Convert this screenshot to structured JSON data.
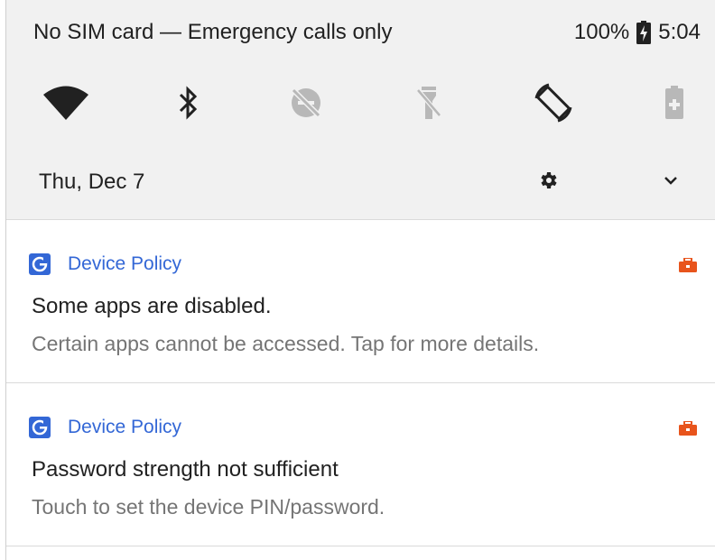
{
  "status_bar": {
    "carrier_text": "No SIM card — Emergency calls only",
    "battery_percent": "100%",
    "battery_icon": "battery-charging-icon",
    "time": "5:04"
  },
  "quick_settings": {
    "tiles": [
      {
        "icon": "wifi-icon",
        "state": "on"
      },
      {
        "icon": "bluetooth-icon",
        "state": "on"
      },
      {
        "icon": "do-not-disturb-off-icon",
        "state": "off"
      },
      {
        "icon": "flashlight-off-icon",
        "state": "off"
      },
      {
        "icon": "auto-rotate-icon",
        "state": "on"
      },
      {
        "icon": "battery-saver-icon",
        "state": "off"
      }
    ]
  },
  "header": {
    "date": "Thu, Dec 7",
    "settings_icon": "gear-icon",
    "expand_icon": "chevron-down-icon"
  },
  "notifications": [
    {
      "app_name": "Device Policy",
      "app_icon": "device-policy-icon",
      "badge_icon": "work-briefcase-icon",
      "title": "Some apps are disabled.",
      "text": "Certain apps cannot be accessed. Tap for more details."
    },
    {
      "app_name": "Device Policy",
      "app_icon": "device-policy-icon",
      "badge_icon": "work-briefcase-icon",
      "title": "Password strength not sufficient",
      "text": "Touch to set the device PIN/password."
    }
  ],
  "colors": {
    "shade_bg": "#f1f1f1",
    "accent_blue": "#3367d6",
    "work_badge_orange": "#e8541c",
    "secondary_text": "#757575",
    "disabled_icon": "#b8b8b8"
  }
}
